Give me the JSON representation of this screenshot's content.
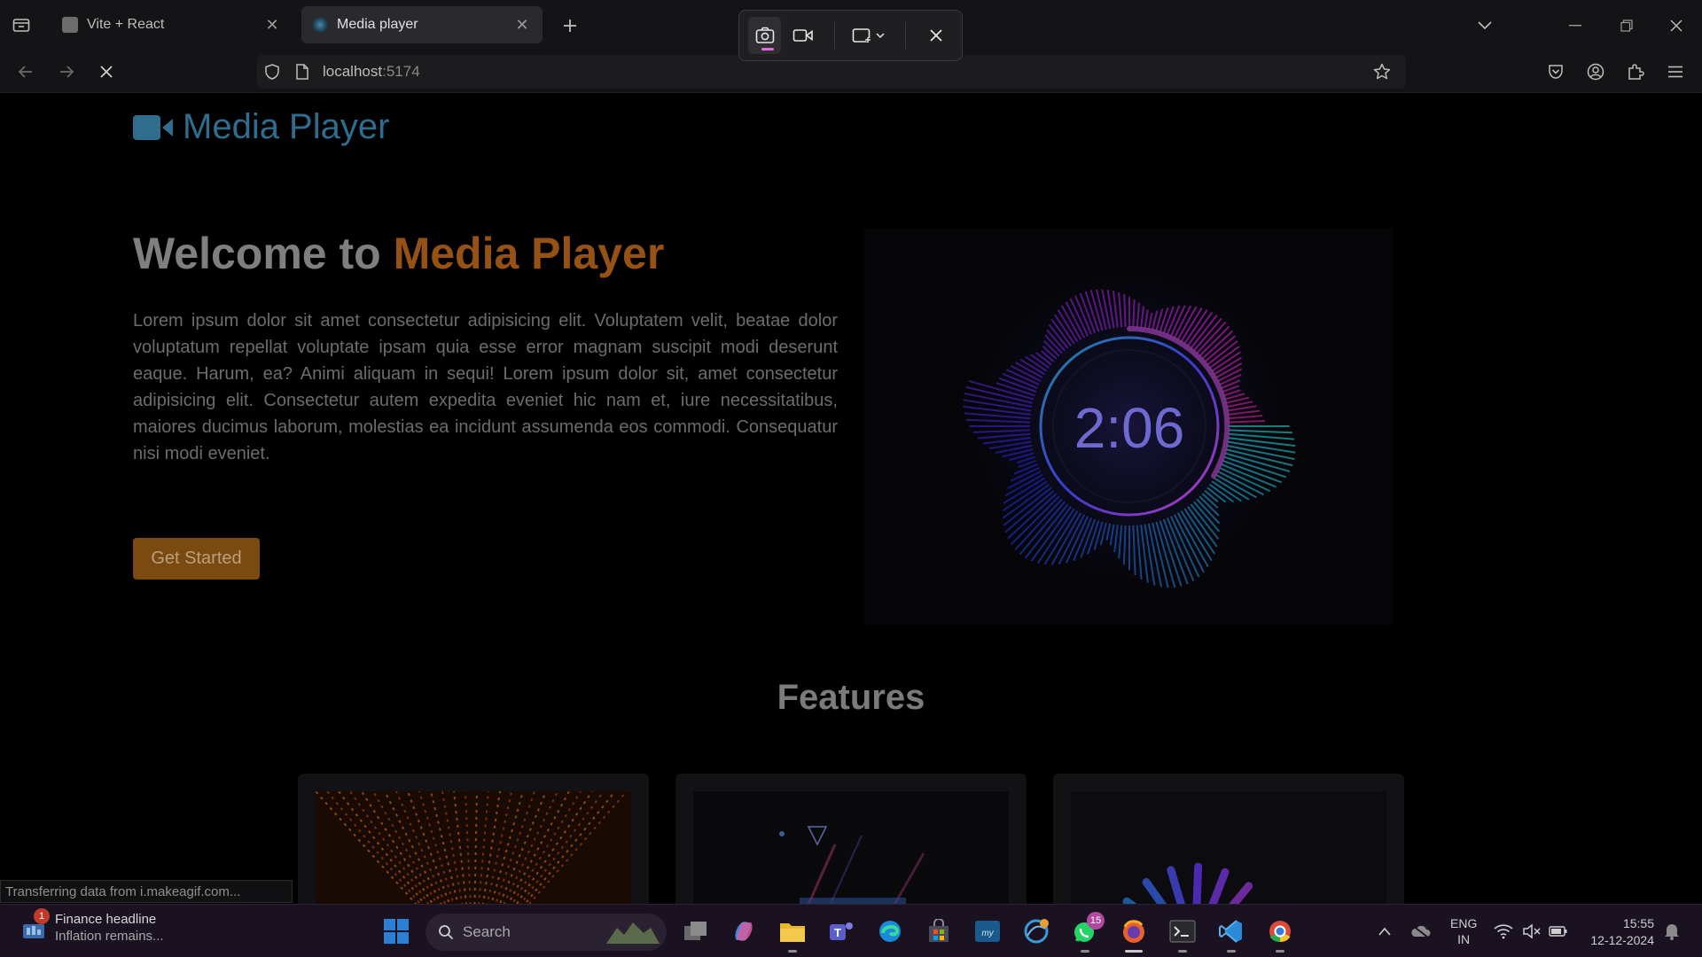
{
  "browser": {
    "tabs": [
      {
        "title": "Vite + React",
        "active": false
      },
      {
        "title": "Media player",
        "active": true
      }
    ],
    "url": {
      "host": "localhost",
      "port": ":5174"
    }
  },
  "page": {
    "logo_text": "Media Player",
    "hero": {
      "title_prefix": "Welcome to ",
      "title_accent": "Media Player",
      "body": "Lorem ipsum dolor sit amet consectetur adipisicing elit. Voluptatem velit, beatae dolor voluptatum repellat voluptate ipsam quia esse error magnam suscipit modi deserunt eaque. Harum, ea? Animi aliquam in sequi! Lorem ipsum dolor sit, amet consectetur adipisicing elit. Consectetur autem expedita eveniet hic nam et, iure necessitatibus, maiores ducimus laborum, molestias ea incidunt assumenda eos commodi. Consequatur nisi modi eveniet.",
      "cta_label": "Get Started",
      "visual_time": "2:06"
    },
    "features_title": "Features",
    "status_text": "Transferring data from i.makeagif.com..."
  },
  "taskbar": {
    "widget": {
      "badge": "1",
      "headline": "Finance headline",
      "subtext": "Inflation remains..."
    },
    "search_placeholder": "Search",
    "whatsapp_badge": "15",
    "language": {
      "line1": "ENG",
      "line2": "IN"
    },
    "time": "15:55",
    "date": "12-12-2024"
  },
  "colors": {
    "accent": "#955214",
    "logo": "#2e6d8e",
    "cta": "#7a4a10"
  }
}
